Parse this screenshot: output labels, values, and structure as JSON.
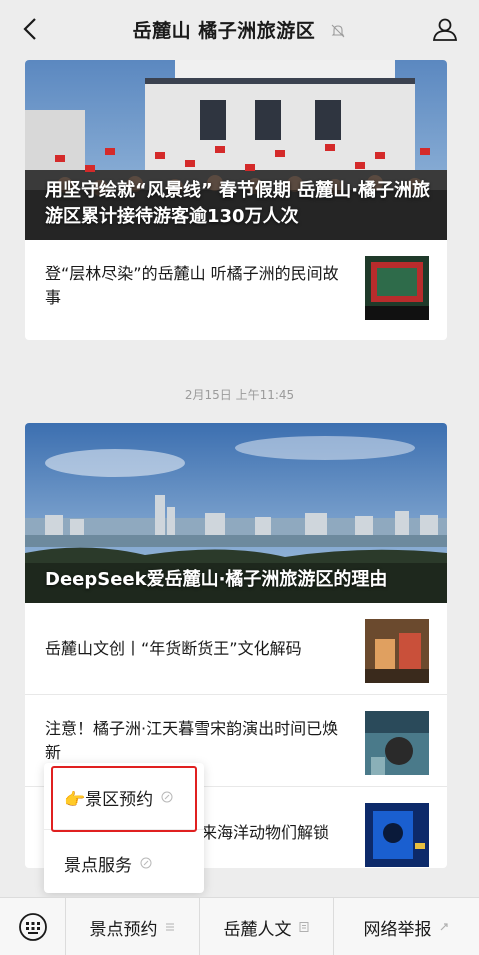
{
  "header": {
    "title": "岳麓山 橘子洲旅游区"
  },
  "feed": {
    "article1": {
      "cover_title": "用坚守绘就“风景线” 春节假期 岳麓山·橘子洲旅游区累计接待游客逾130万人次",
      "sub_items": [
        {
          "title": "登“层林尽染”的岳麓山 听橘子洲的民间故事"
        }
      ]
    },
    "timestamp": "2月15日 上午11:45",
    "article2": {
      "cover_title": "DeepSeek爱岳麓山·橘子洲旅游区的理由",
      "sub_items": [
        {
          "title": "岳麓山文创丨“年货断货王”文化解码"
        },
        {
          "title": "注意！橘子洲·江天暮雪宋韵演出时间已焕新"
        },
        {
          "title": "丨来海洋动物们解锁"
        }
      ]
    }
  },
  "popup_menu": {
    "items": [
      {
        "label": "👉景区预约"
      },
      {
        "label": "景点服务"
      }
    ]
  },
  "bottom_menu": {
    "items": [
      {
        "label": "景点预约"
      },
      {
        "label": "岳麓人文"
      },
      {
        "label": "网络举报"
      }
    ]
  },
  "colors": {
    "highlight_border": "#e02020",
    "background": "#ededed"
  }
}
